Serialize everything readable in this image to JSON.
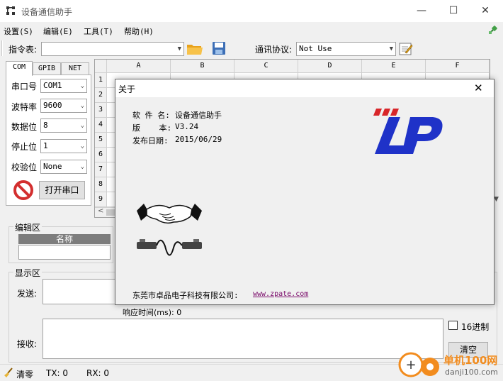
{
  "window": {
    "title": "设备通信助手",
    "minimize": "—",
    "maximize": "☐",
    "close": "✕"
  },
  "menu": [
    "设置(S)",
    "编辑(E)",
    "工具(T)",
    "帮助(H)"
  ],
  "toolbar": {
    "command_label": "指令表:",
    "command_value": "",
    "protocol_label": "通讯协议:",
    "protocol_value": "Not Use"
  },
  "tabs": [
    "COM",
    "GPIB",
    "NET"
  ],
  "serial": {
    "port_label": "串口号",
    "port_value": "COM1",
    "baud_label": "波特率",
    "baud_value": "9600",
    "data_label": "数据位",
    "data_value": "8",
    "stop_label": "停止位",
    "stop_value": "1",
    "parity_label": "校验位",
    "parity_value": "None",
    "open_button": "打开串口"
  },
  "grid": {
    "columns": [
      "A",
      "B",
      "C",
      "D",
      "E",
      "F"
    ],
    "rows": [
      "1",
      "2",
      "3",
      "4",
      "5",
      "6",
      "7",
      "8",
      "9"
    ]
  },
  "edit_area": {
    "title": "编辑区",
    "name_header": "名称"
  },
  "display_area": {
    "title": "显示区",
    "send_label": "发送:",
    "response_label": "响应时间(ms): 0",
    "receive_label": "接收:",
    "hex_label": "16进制",
    "clear_button": "清空"
  },
  "status": {
    "clear_label": "清零",
    "tx": "TX:  0",
    "rx": "RX:  0"
  },
  "about": {
    "title": "关于",
    "close": "✕",
    "software_label": "软 件 名:",
    "software_value": "设备通信助手",
    "version_label": "版    本:",
    "version_value": "V3.24",
    "date_label": "发布日期:",
    "date_value": "2015/06/29",
    "company": "东莞市卓品电子科技有限公司:",
    "website": "www.zpate.com",
    "logo_color": "#1f32c8",
    "logo_accent": "#d8262a"
  },
  "watermark": {
    "text": "单机100网",
    "url": "danji100.com"
  }
}
